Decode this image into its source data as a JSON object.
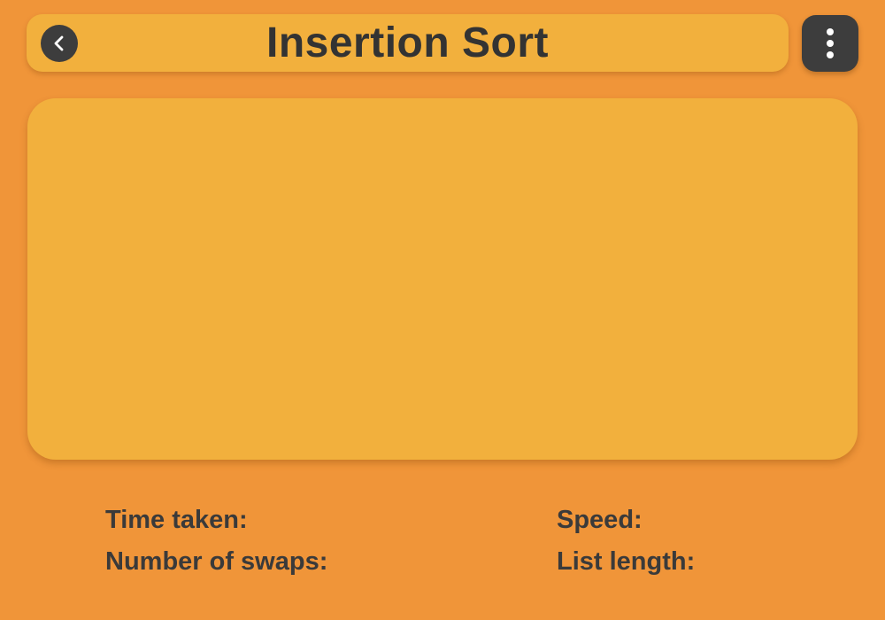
{
  "header": {
    "title": "Insertion Sort",
    "back_icon": "chevron-left-icon",
    "menu_icon": "more-vertical-icon"
  },
  "visualizer": {
    "bars": []
  },
  "stats": {
    "time_taken_label": "Time taken:",
    "time_taken_value": "",
    "swaps_label": "Number of swaps:",
    "swaps_value": "",
    "speed_label": "Speed:",
    "speed_value": "",
    "list_length_label": "List length:",
    "list_length_value": ""
  },
  "colors": {
    "background": "#F09539",
    "panel": "#F2B03D",
    "button": "#3D3D3D",
    "text": "#333333"
  }
}
